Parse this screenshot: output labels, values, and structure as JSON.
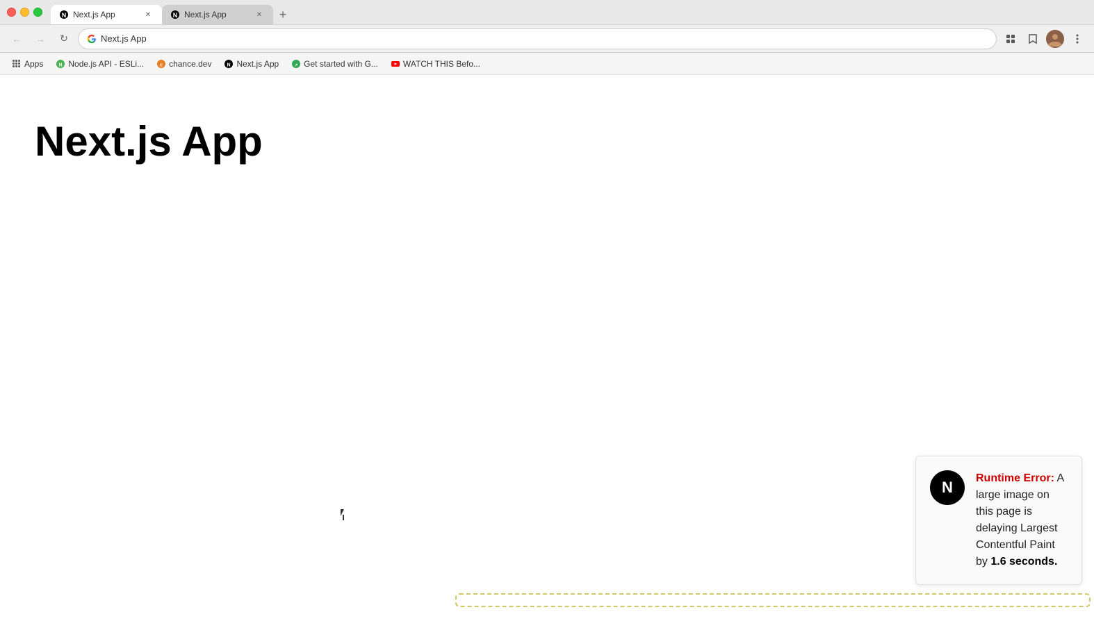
{
  "titlebar": {
    "tab1": {
      "title": "Next.js App",
      "favicon": "next"
    },
    "tab2": {
      "title": "Next.js App",
      "favicon": "next"
    },
    "new_tab_label": "+"
  },
  "toolbar": {
    "back_label": "←",
    "forward_label": "→",
    "reload_label": "↻",
    "address": "Next.js App",
    "address_url": "Next.js App",
    "extensions_label": "⊞",
    "bookmark_label": "☆",
    "menu_label": "⋮"
  },
  "bookmarks": {
    "apps_label": "Apps",
    "items": [
      {
        "id": "nodejs",
        "label": "Node.js API - ESLi...",
        "color": "#4CAF50"
      },
      {
        "id": "chancedev",
        "label": "chance.dev",
        "color": "#e67e22"
      },
      {
        "id": "nextjs",
        "label": "Next.js App",
        "color": "#000"
      },
      {
        "id": "getstarted",
        "label": "Get started with G...",
        "color": "#34a853"
      },
      {
        "id": "youtube",
        "label": "WATCH THIS Befo...",
        "color": "#ff0000"
      }
    ]
  },
  "page": {
    "heading": "Next.js App"
  },
  "error_panel": {
    "logo_letter": "N",
    "error_label": "Runtime Error:",
    "error_message": " A large image on this page is delaying Largest Contentful Paint by ",
    "error_bold": "1.6 seconds."
  }
}
